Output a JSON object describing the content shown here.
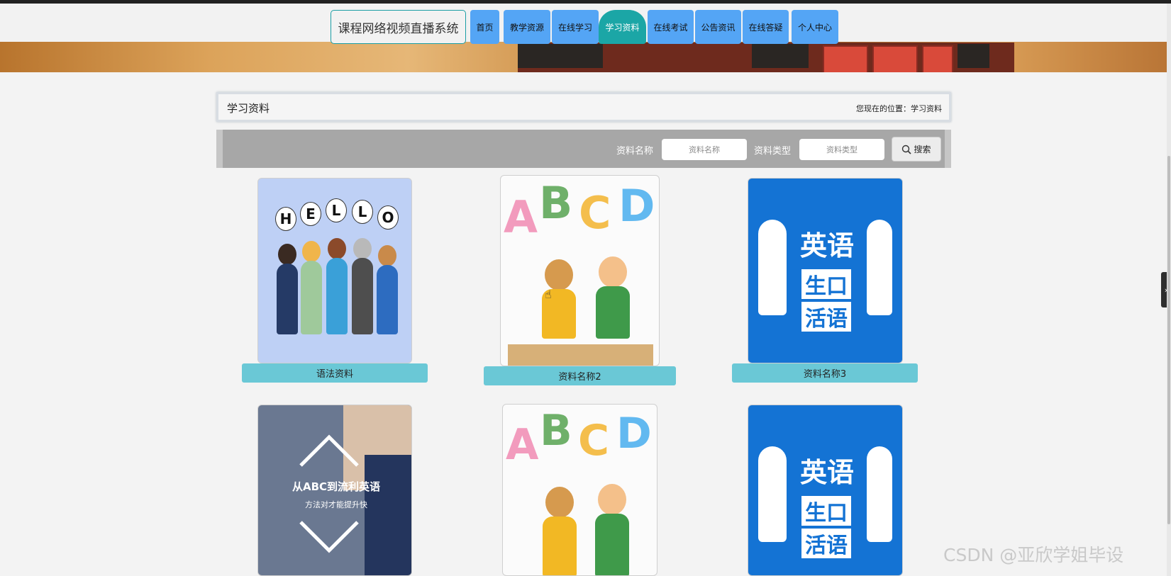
{
  "nav": {
    "brand": "课程网络视频直播系统",
    "items": [
      {
        "label": "首页"
      },
      {
        "label": "教学资源"
      },
      {
        "label": "在线学习"
      },
      {
        "label": "学习资料"
      },
      {
        "label": "在线考试"
      },
      {
        "label": "公告资讯"
      },
      {
        "label": "在线答疑"
      },
      {
        "label": "个人中心"
      }
    ],
    "active": "学习资料"
  },
  "page": {
    "title": "学习资料",
    "location": "您现在的位置：学习资料"
  },
  "search": {
    "name_label": "资料名称",
    "name_placeholder": "资料名称",
    "type_label": "资料类型",
    "type_placeholder": "资料类型",
    "button": "搜索"
  },
  "cards": [
    {
      "caption": "语法资料",
      "image": "hello-kids-illustration"
    },
    {
      "caption": "资料名称2",
      "image": "abcd-kids-illustration"
    },
    {
      "caption": "资料名称3",
      "image": "english-spoken-blue"
    },
    {
      "caption": "",
      "image": "student-abc-fluent",
      "text1": "从ABC到流利英语",
      "text2": "方法对才能提升快"
    },
    {
      "caption": "",
      "image": "abcd-kids-illustration"
    },
    {
      "caption": "",
      "image": "english-spoken-blue"
    }
  ],
  "art": {
    "hello_letters": [
      "H",
      "E",
      "L",
      "L",
      "O"
    ],
    "abcd_letters": [
      "A",
      "B",
      "C",
      "D"
    ],
    "blue_title": "英语",
    "blue_sub1": "生口",
    "blue_sub2": "活语"
  },
  "watermark": "CSDN @亚欣学姐毕设",
  "colors": {
    "nav": "#54a5f5",
    "active": "#1ba6a6",
    "caption": "#6ac8d6",
    "searchbar": "#a7a7a7"
  }
}
